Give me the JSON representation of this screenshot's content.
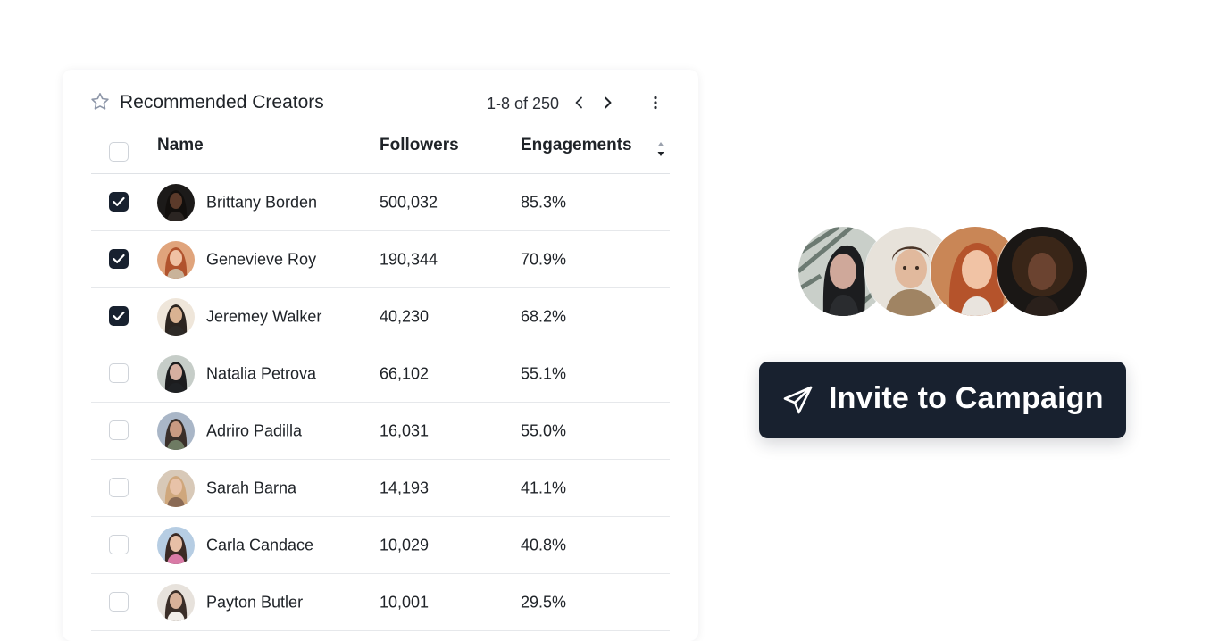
{
  "card": {
    "title": "Recommended Creators",
    "pagination": "1-8 of 250"
  },
  "table": {
    "columns": [
      "Name",
      "Followers",
      "Engagements"
    ],
    "rows": [
      {
        "name": "Brittany Borden",
        "followers": "500,032",
        "engagements": "85.3%",
        "checked": true
      },
      {
        "name": "Genevieve Roy",
        "followers": "190,344",
        "engagements": "70.9%",
        "checked": true
      },
      {
        "name": "Jeremey Walker",
        "followers": "40,230",
        "engagements": "68.2%",
        "checked": true
      },
      {
        "name": "Natalia Petrova",
        "followers": "66,102",
        "engagements": "55.1%",
        "checked": false
      },
      {
        "name": "Adriro Padilla",
        "followers": "16,031",
        "engagements": "55.0%",
        "checked": false
      },
      {
        "name": "Sarah Barna",
        "followers": "14,193",
        "engagements": "41.1%",
        "checked": false
      },
      {
        "name": "Carla Candace",
        "followers": "10,029",
        "engagements": "40.8%",
        "checked": false
      },
      {
        "name": "Payton Butler",
        "followers": "10,001",
        "engagements": "29.5%",
        "checked": false
      }
    ]
  },
  "invite": {
    "label": "Invite to Campaign"
  },
  "icons": {
    "title": "star-icon",
    "prev": "chevron-left-icon",
    "next": "chevron-right-icon",
    "more": "more-vertical-icon",
    "sort": "sort-icon",
    "check": "check-icon",
    "invite": "send-icon"
  },
  "colors": {
    "primary_dark": "#18212f",
    "border": "#e6e8eb",
    "text": "#1f2328"
  }
}
